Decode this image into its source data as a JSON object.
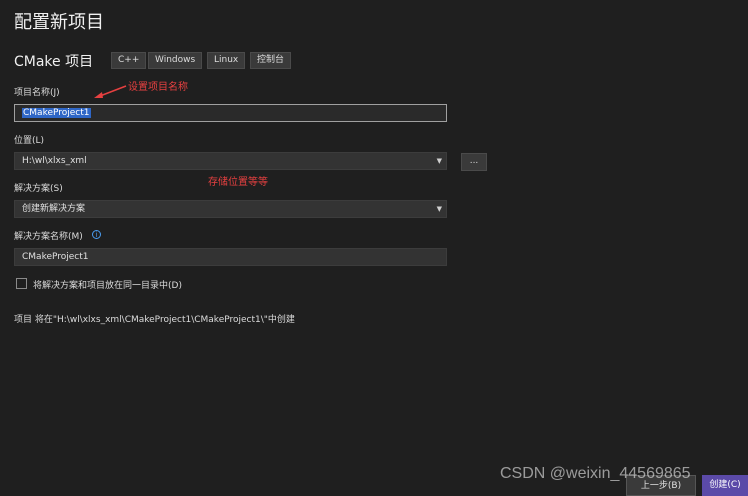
{
  "page": {
    "title": "配置新项目",
    "project_type": "CMake 项目",
    "tags": [
      "C++",
      "Windows",
      "Linux",
      "控制台"
    ]
  },
  "form": {
    "project_name_label": "项目名称(J)",
    "project_name_value": "CMakeProject1",
    "location_label": "位置(L)",
    "location_value": "H:\\wl\\xlxs_xml",
    "browse_label": "...",
    "solution_label": "解决方案(S)",
    "solution_value": "创建新解决方案",
    "solution_name_label": "解决方案名称(M)",
    "solution_name_value": "CMakeProject1",
    "same_dir_checkbox_label": "将解决方案和项目放在同一目录中(D)",
    "same_dir_checked": false,
    "summary": "项目 将在\"H:\\wl\\xlxs_xml\\CMakeProject1\\CMakeProject1\\\"中创建"
  },
  "annotations": {
    "name_note": "设置项目名称",
    "location_note": "存储位置等等"
  },
  "buttons": {
    "back": "上一步(B)",
    "create": "创建(C)"
  },
  "watermark": "CSDN @weixin_44569865",
  "colors": {
    "background": "#1f1f1f",
    "annotation": "#e64040",
    "selection": "#2f67c7",
    "primary_button": "#5b4aa8"
  }
}
